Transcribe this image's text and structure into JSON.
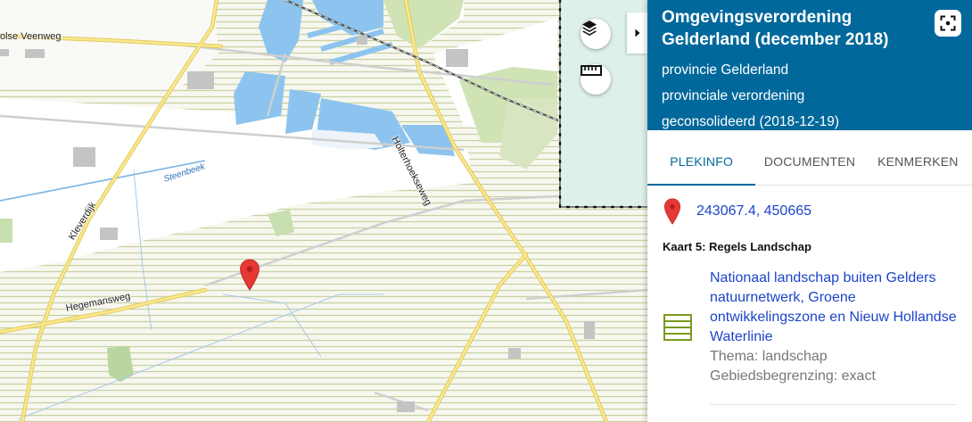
{
  "map": {
    "streets": [
      {
        "id": "street-olse-veenweg",
        "label": "olse Veenweg"
      },
      {
        "id": "street-holterhoeksweg",
        "label": "Holterhoekseweg"
      },
      {
        "id": "street-kleverdijk",
        "label": "Kleverdijk"
      },
      {
        "id": "street-hegemansweg",
        "label": "Hegemansweg"
      }
    ],
    "waters": [
      {
        "id": "water-steenbeek",
        "label": "Steenbeek"
      }
    ],
    "controls": {
      "layers_icon": "layers-icon",
      "measure_icon": "ruler-icon",
      "collapse_icon": "chevron-right-icon"
    },
    "marker_icon": "map-marker-icon",
    "colors": {
      "marker": "#e53935",
      "water": "#8cc4ef",
      "hatch": "#c6d3a3",
      "road": "#f4dd79",
      "boundary_fill": "#def0ea"
    }
  },
  "panel": {
    "title": "Omgevingsverordening Gelderland (december 2018)",
    "publisher": "provincie Gelderland",
    "doc_type": "provinciale verordening",
    "status": "geconsolideerd (2018-12-19)",
    "fullscreen_icon": "fullscreen-icon",
    "header_color": "#01689b",
    "tabs": [
      {
        "label": "PLEKINFO",
        "active": true
      },
      {
        "label": "DOCUMENTEN",
        "active": false
      },
      {
        "label": "KENMERKEN",
        "active": false
      }
    ],
    "location": {
      "icon": "map-marker-icon",
      "coords": "243067.4, 450665"
    },
    "section_title": "Kaart 5: Regels Landschap",
    "result": {
      "icon": "hatched-area-icon",
      "title": "Nationaal landschap buiten Gelders natuurnetwerk, Groene ontwikkelingszone en Nieuw Hollandse Waterlinie",
      "theme": "Thema: landschap",
      "boundary": "Gebiedsbegrenzing: exact"
    }
  }
}
